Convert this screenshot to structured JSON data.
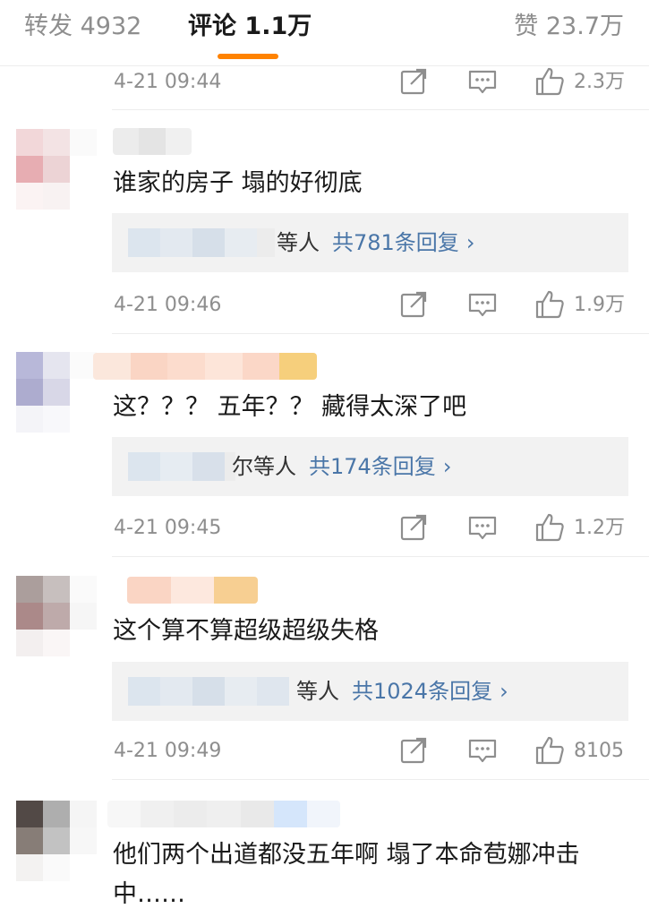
{
  "tabs": {
    "repost_label": "转发",
    "repost_count": "4932",
    "comment_label": "评论",
    "comment_count": "1.1万",
    "like_label": "赞",
    "like_count": "23.7万"
  },
  "accent_color": "#ff8200",
  "link_color": "#4a76a8",
  "top_meta": {
    "time": "4-21 09:44",
    "likes": "2.3万"
  },
  "comments": [
    {
      "text": "谁家的房子 塌的好彻底",
      "reply_who": "等人",
      "reply_count": "共781条回复",
      "time": "4-21 09:46",
      "likes": "1.9万"
    },
    {
      "text": "这？？？ 五年？？ 藏得太深了吧",
      "reply_who": "尔等人",
      "reply_count": "共174条回复",
      "time": "4-21 09:45",
      "likes": "1.2万"
    },
    {
      "text": "这个算不算超级超级失格",
      "reply_who": "等人",
      "reply_count": "共1024条回复",
      "time": "4-21 09:49",
      "likes": "8105"
    },
    {
      "text": "他们两个出道都没五年啊 塌了本命苞娜冲击中……"
    }
  ],
  "icons": {
    "share": "share-icon",
    "reply": "comment-icon",
    "like": "thumbs-up-icon",
    "chevron": "chevron-right-icon"
  }
}
